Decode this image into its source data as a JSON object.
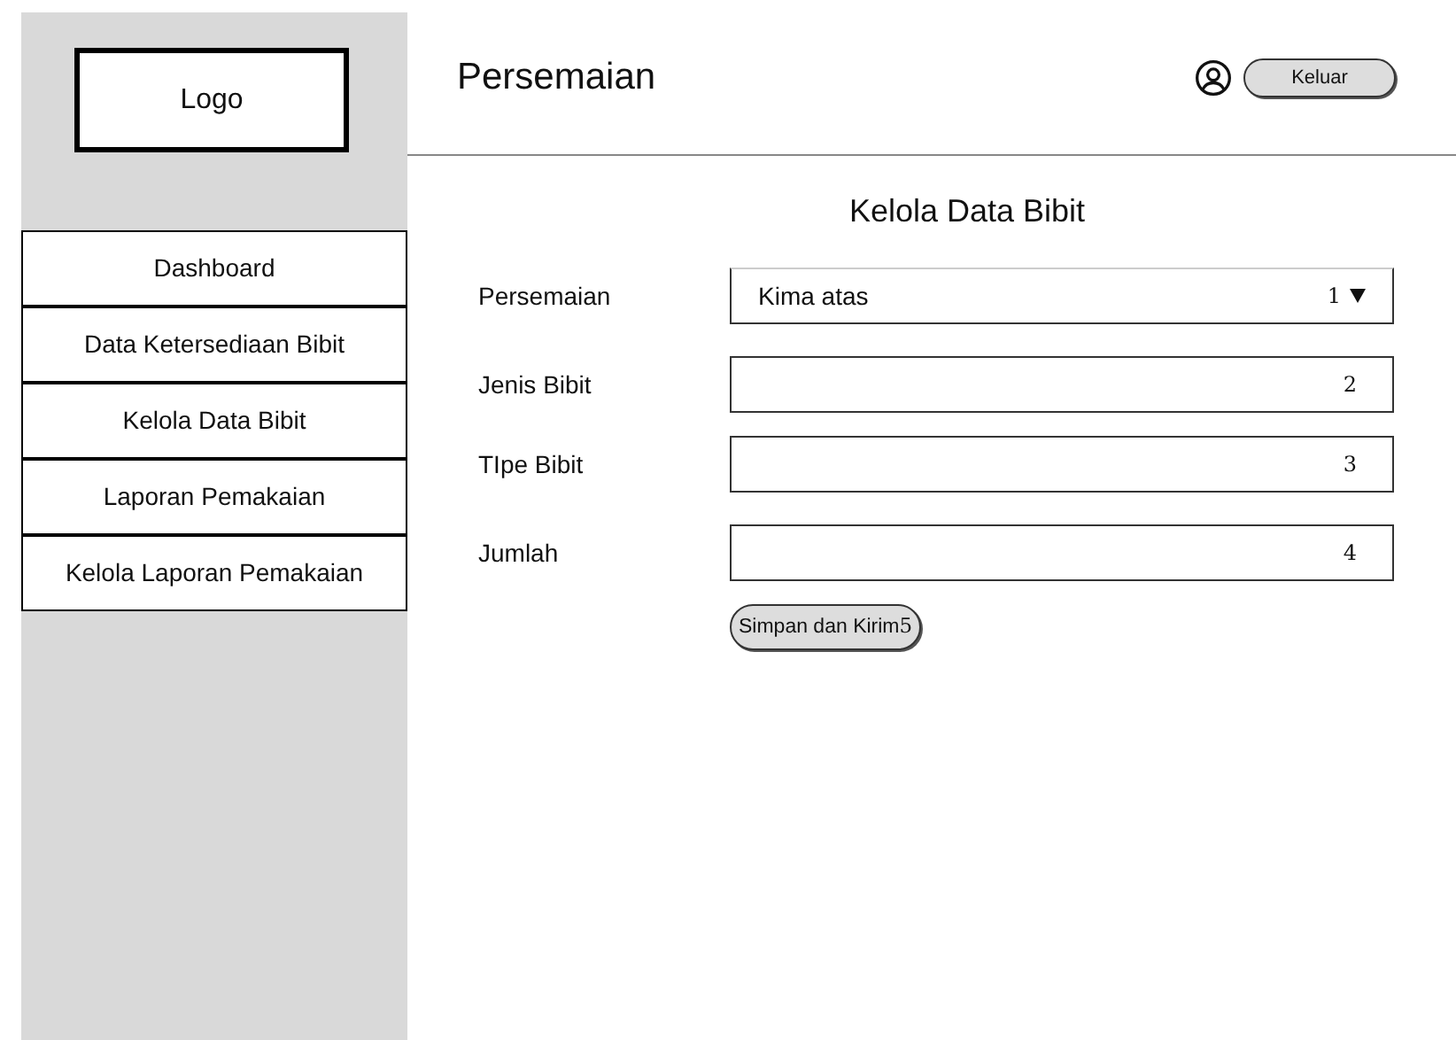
{
  "sidebar": {
    "logo": "Logo",
    "items": [
      {
        "label": "Dashboard"
      },
      {
        "label": "Data Ketersediaan Bibit"
      },
      {
        "label": "Kelola Data Bibit"
      },
      {
        "label": "Laporan Pemakaian"
      },
      {
        "label": "Kelola Laporan Pemakaian"
      }
    ]
  },
  "header": {
    "title": "Persemaian",
    "logout": "Keluar"
  },
  "form": {
    "title": "Kelola Data Bibit",
    "fields": [
      {
        "kind": "select",
        "label": "Persemaian",
        "value": "Kima atas",
        "marker": "1"
      },
      {
        "kind": "text",
        "label": "Jenis Bibit",
        "marker": "2"
      },
      {
        "kind": "text",
        "label": "TIpe Bibit",
        "marker": "3"
      },
      {
        "kind": "text",
        "label": "Jumlah",
        "marker": "4"
      }
    ],
    "submit": {
      "label": "Simpan dan Kirim",
      "marker": "5"
    }
  }
}
